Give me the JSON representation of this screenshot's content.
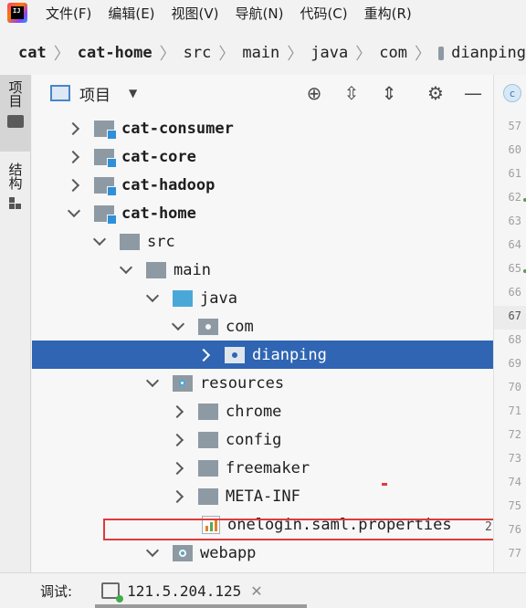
{
  "menubar": {
    "logo_text": "IJ",
    "items": [
      "文件(F)",
      "编辑(E)",
      "视图(V)",
      "导航(N)",
      "代码(C)",
      "重构(R)"
    ]
  },
  "breadcrumb": [
    "cat",
    "cat-home",
    "src",
    "main",
    "java",
    "com",
    "dianping"
  ],
  "left_strip": {
    "project_tab": "项目",
    "structure_tab": "结构"
  },
  "panel": {
    "title": "项目"
  },
  "tree": [
    {
      "label": "cat-consumer",
      "chev": "right",
      "icon": "module",
      "bold": true
    },
    {
      "label": "cat-core",
      "chev": "right",
      "icon": "module",
      "bold": true
    },
    {
      "label": "cat-hadoop",
      "chev": "right",
      "icon": "module",
      "bold": true
    },
    {
      "label": "cat-home",
      "chev": "down",
      "icon": "module",
      "bold": true
    },
    {
      "label": "src",
      "chev": "down",
      "icon": "plain",
      "bold": false
    },
    {
      "label": "main",
      "chev": "down",
      "icon": "plain",
      "bold": false
    },
    {
      "label": "java",
      "chev": "down",
      "icon": "blue",
      "bold": false
    },
    {
      "label": "com",
      "chev": "down",
      "icon": "pkg",
      "bold": false
    },
    {
      "label": "dianping",
      "chev": "right",
      "icon": "pkg",
      "bold": false,
      "selected": true
    },
    {
      "label": "resources",
      "chev": "down",
      "icon": "res",
      "bold": false
    },
    {
      "label": "chrome",
      "chev": "right",
      "icon": "plain",
      "bold": false
    },
    {
      "label": "config",
      "chev": "right",
      "icon": "plain",
      "bold": false
    },
    {
      "label": "freemaker",
      "chev": "right",
      "icon": "plain",
      "bold": false
    },
    {
      "label": "META-INF",
      "chev": "right",
      "icon": "plain",
      "bold": false
    },
    {
      "label": "onelogin.saml.properties",
      "chev": "none",
      "icon": "props",
      "bold": false
    },
    {
      "label": "webapp",
      "chev": "down",
      "icon": "web",
      "bold": false
    }
  ],
  "gutter": {
    "tab_letter": "c",
    "lines": [
      "57",
      "60",
      "61",
      "62",
      "63",
      "64",
      "65",
      "66",
      "67",
      "68",
      "69",
      "70",
      "71",
      "72",
      "73",
      "74",
      "75",
      "76",
      "77"
    ],
    "current_line": "67",
    "note": "2"
  },
  "debug": {
    "label": "调试:",
    "session": "121.5.204.125",
    "close": "✕"
  }
}
